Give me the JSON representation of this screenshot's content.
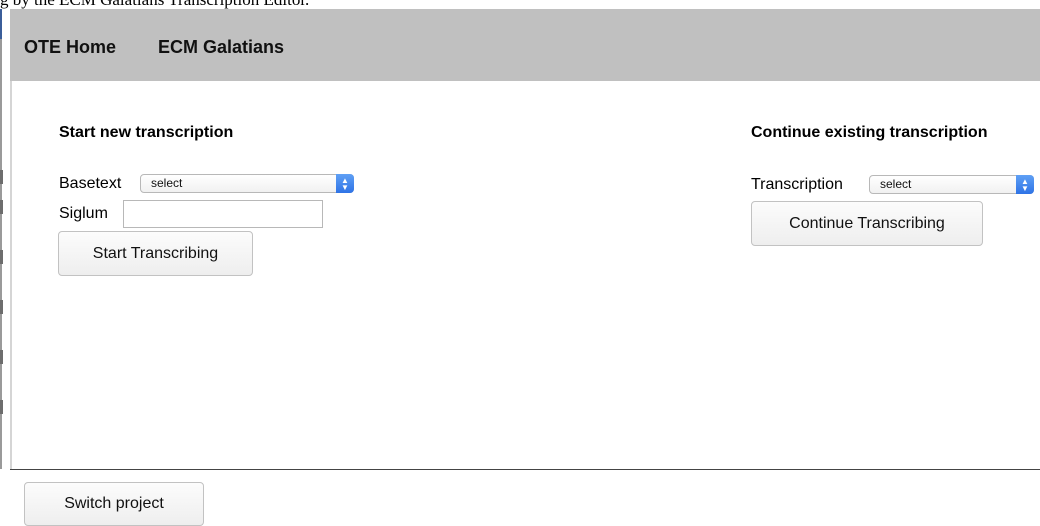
{
  "caption": "g by the ECM Galatians Transcription Editor.",
  "nav": {
    "items": [
      {
        "label": "OTE Home"
      },
      {
        "label": "ECM Galatians"
      }
    ]
  },
  "start_section": {
    "heading": "Start new transcription",
    "basetext_label": "Basetext",
    "basetext_value": "select",
    "siglum_label": "Siglum",
    "siglum_value": "",
    "start_button": "Start Transcribing"
  },
  "continue_section": {
    "heading": "Continue existing transcription",
    "transcription_label": "Transcription",
    "transcription_value": "select",
    "continue_button": "Continue Transcribing"
  },
  "footer": {
    "switch_button": "Switch project"
  },
  "colors": {
    "navbar_bg": "#c0c0c0",
    "select_arrow": "#2e73e6"
  },
  "icons": {
    "select_arrow": "chevron-up-down-icon"
  }
}
